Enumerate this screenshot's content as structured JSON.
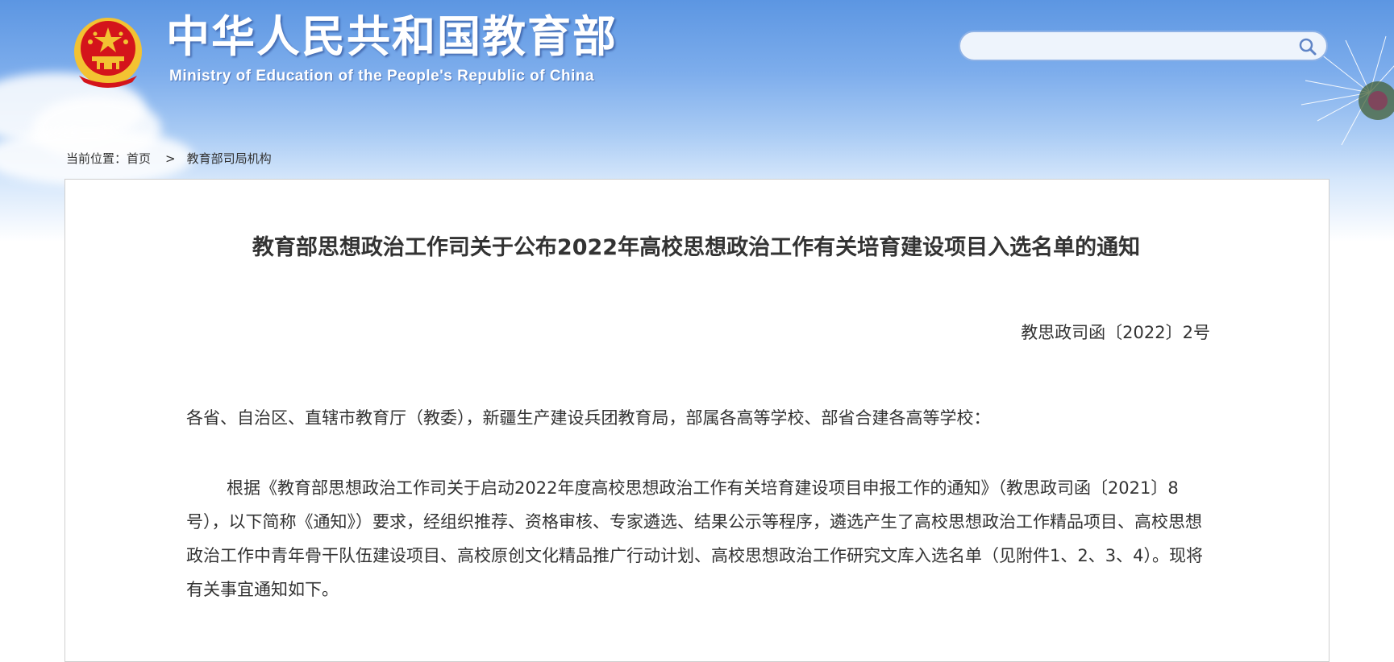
{
  "header": {
    "site_title": "中华人民共和国教育部",
    "site_subtitle": "Ministry of Education of the People's Republic of China",
    "emblem_icon": "national-emblem-icon",
    "search": {
      "placeholder": "",
      "icon": "search-icon"
    }
  },
  "breadcrumb": {
    "prefix": "当前位置：",
    "items": [
      {
        "label": "首页"
      },
      {
        "label": "教育部司局机构"
      }
    ],
    "separator": ">"
  },
  "article": {
    "title": "教育部思想政治工作司关于公布2022年高校思想政治工作有关培育建设项目入选名单的通知",
    "doc_number": "教思政司函〔2022〕2号",
    "salutation": "各省、自治区、直辖市教育厅（教委），新疆生产建设兵团教育局，部属各高等学校、部省合建各高等学校：",
    "paragraphs": [
      "根据《教育部思想政治工作司关于启动2022年度高校思想政治工作有关培育建设项目申报工作的通知》（教思政司函〔2021〕8号），以下简称《通知》）要求，经组织推荐、资格审核、专家遴选、结果公示等程序，遴选产生了高校思想政治工作精品项目、高校思想政治工作中青年骨干队伍建设项目、高校原创文化精品推广行动计划、高校思想政治工作研究文库入选名单（见附件1、2、3、4）。现将有关事宜通知如下。"
    ]
  },
  "colors": {
    "banner_top": "#5c96e2",
    "text": "#333333",
    "border": "#cfcfcf",
    "emblem_red": "#d4141b",
    "emblem_gold": "#f3c232"
  }
}
